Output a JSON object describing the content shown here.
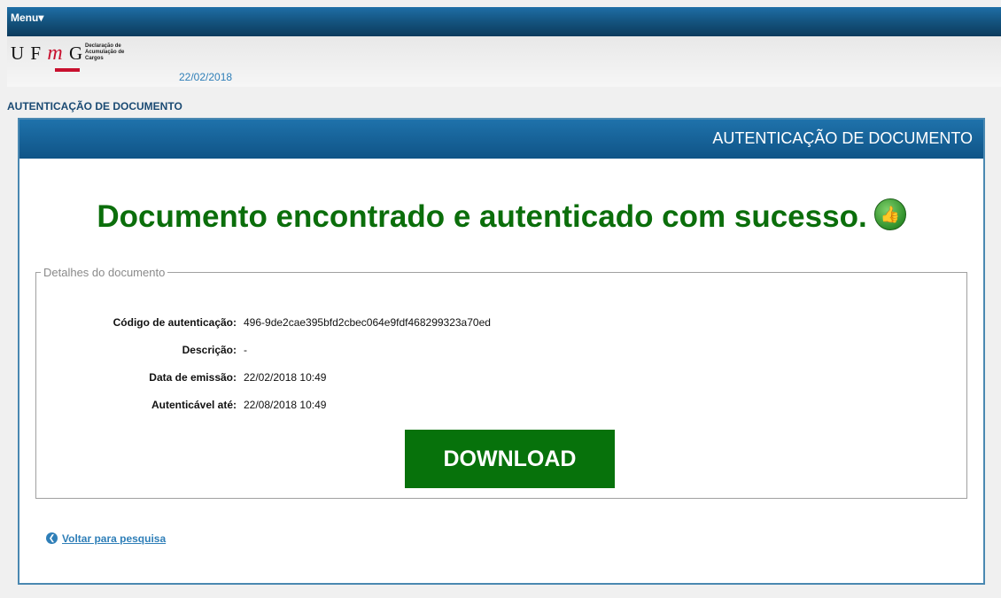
{
  "topbar": {
    "menu_label": "Menu▾"
  },
  "header": {
    "logo_letters": {
      "u": "U",
      "f": "F",
      "m": "m",
      "g": "G"
    },
    "logo_subtitle": "Declaração de Acumulação de Cargos",
    "date": "22/02/2018"
  },
  "breadcrumb": "AUTENTICAÇÃO DE DOCUMENTO",
  "panel": {
    "title": "AUTENTICAÇÃO DE DOCUMENTO",
    "success_message": "Documento encontrado e autenticado com sucesso.",
    "details": {
      "legend": "Detalhes do documento",
      "fields": [
        {
          "label": "Código de autenticação:",
          "value": "496-9de2cae395bfd2cbec064e9fdf468299323a70ed"
        },
        {
          "label": "Descrição:",
          "value": "-"
        },
        {
          "label": "Data de emissão:",
          "value": "22/02/2018 10:49"
        },
        {
          "label": "Autenticável até:",
          "value": "22/08/2018 10:49"
        }
      ],
      "download_label": "DOWNLOAD"
    },
    "back_link": "Voltar para pesquisa"
  },
  "icons": {
    "thumbs_up": "thumbs-up-icon",
    "back_arrow": "arrow-left-circle-icon"
  },
  "colors": {
    "success_green": "#0b6e0b",
    "download_green": "#07720b",
    "header_blue": "#155682",
    "link_blue": "#2f7fb8"
  }
}
